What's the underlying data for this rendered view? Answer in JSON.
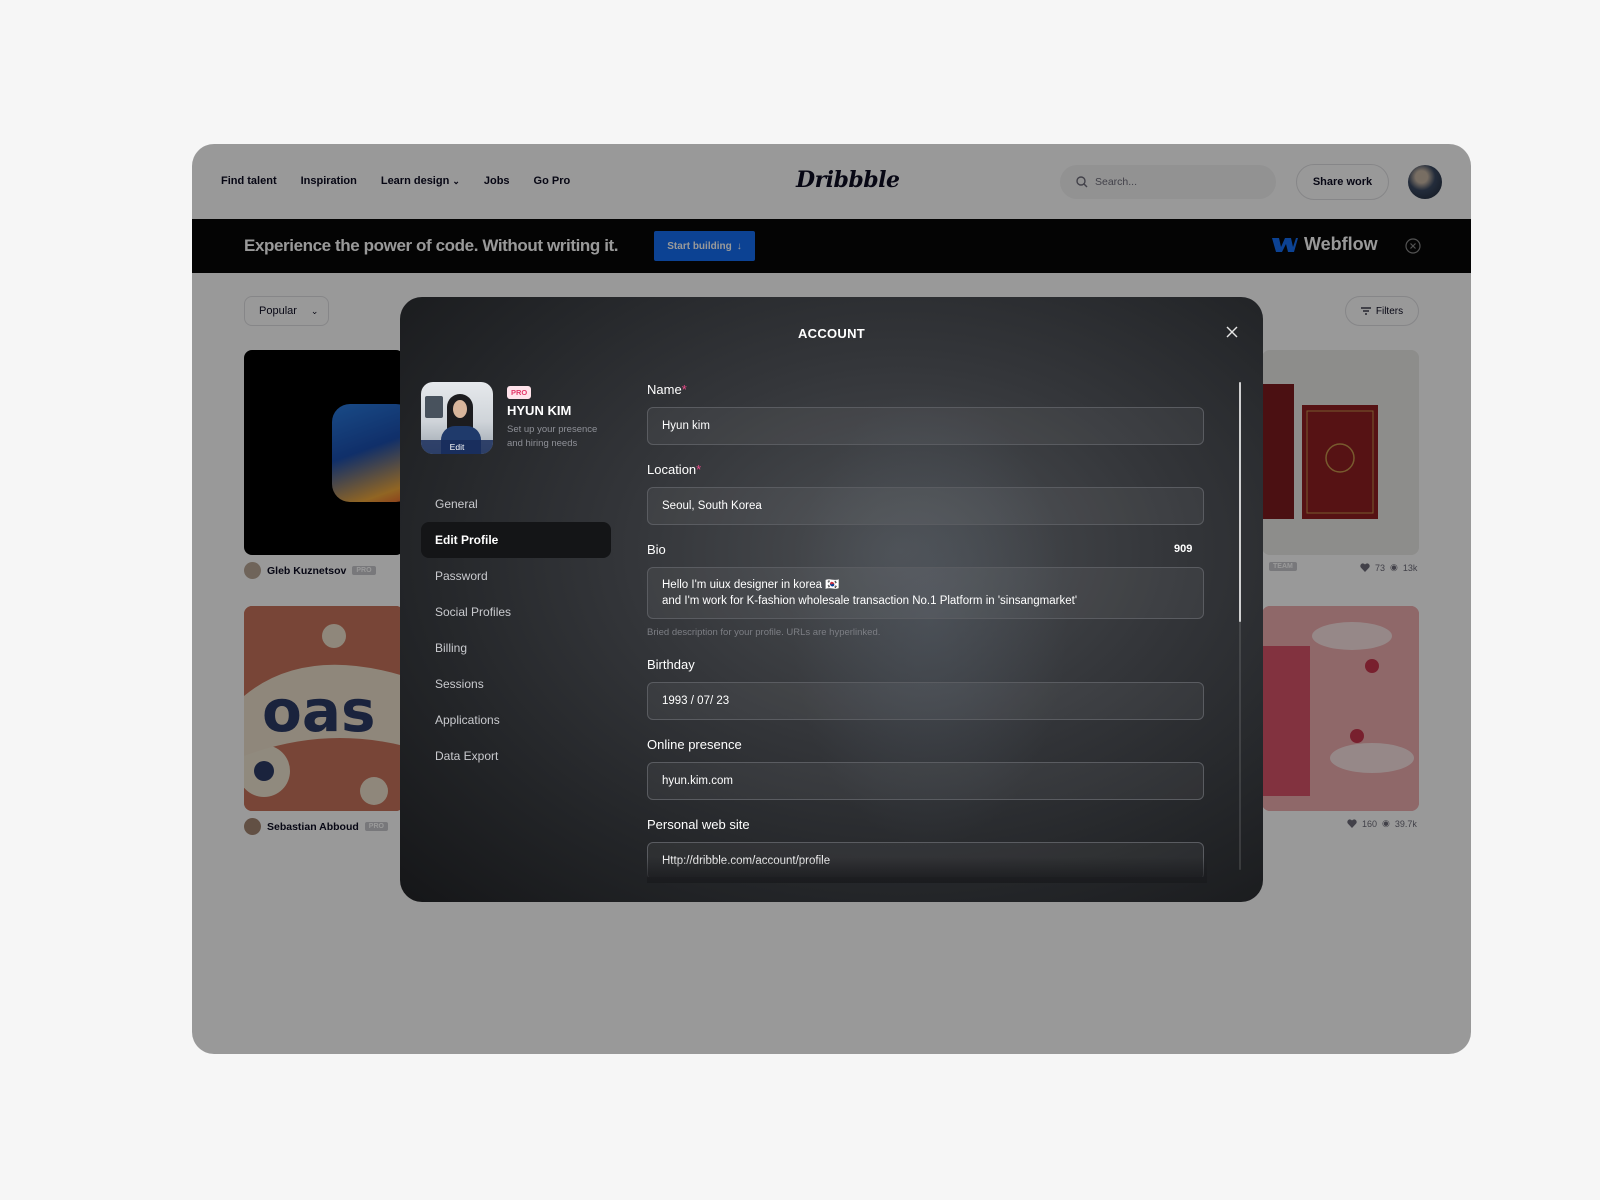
{
  "nav": {
    "links": [
      "Find talent",
      "Inspiration",
      "Learn design",
      "Jobs",
      "Go Pro"
    ],
    "logo": "Dribbble",
    "search_placeholder": "Search...",
    "share_label": "Share work"
  },
  "banner": {
    "text": "Experience the power of code. Without writing it.",
    "cta": "Start building",
    "brand": "Webflow"
  },
  "feed": {
    "sort_label": "Popular",
    "filters_label": "Filters",
    "shots": [
      {
        "author": "Gleb Kuznetsov",
        "badge": "PRO"
      },
      {
        "author": "Sebastian Abboud",
        "badge": "PRO"
      },
      {
        "badge": "TEAM",
        "likes": "73",
        "views": "13k"
      },
      {
        "likes": "160",
        "views": "39.7k"
      }
    ]
  },
  "modal": {
    "title": "ACCOUNT",
    "profile": {
      "badge": "PRO",
      "name": "HYUN KIM",
      "subtitle": "Set up your presence and hiring needs",
      "edit_label": "Edit"
    },
    "menu": [
      "General",
      "Edit Profile",
      "Password",
      "Social Profiles",
      "Billing",
      "Sessions",
      "Applications",
      "Data Export"
    ],
    "active_menu": "Edit Profile",
    "form": {
      "name_label": "Name",
      "name_value": "Hyun kim",
      "location_label": "Location",
      "location_value": "Seoul, South Korea",
      "bio_label": "Bio",
      "bio_counter": "909",
      "bio_line1": "Hello I'm uiux designer in korea 🇰🇷",
      "bio_line2": "and I'm work for K-fashion wholesale transaction No.1 Platform in 'sinsangmarket'",
      "bio_helper": "Bried description for your profile. URLs are hyperlinked.",
      "birthday_label": "Birthday",
      "birthday_value": "1993 / 07/ 23",
      "online_label": "Online presence",
      "online_value": "hyun.kim.com",
      "website_label": "Personal web site",
      "website_value": "Http://dribble.com/account/profile"
    }
  },
  "colors": {
    "accent_pink": "#ea4c89",
    "webflow_blue": "#146ef5",
    "modal_bg": "#2a2c30"
  }
}
